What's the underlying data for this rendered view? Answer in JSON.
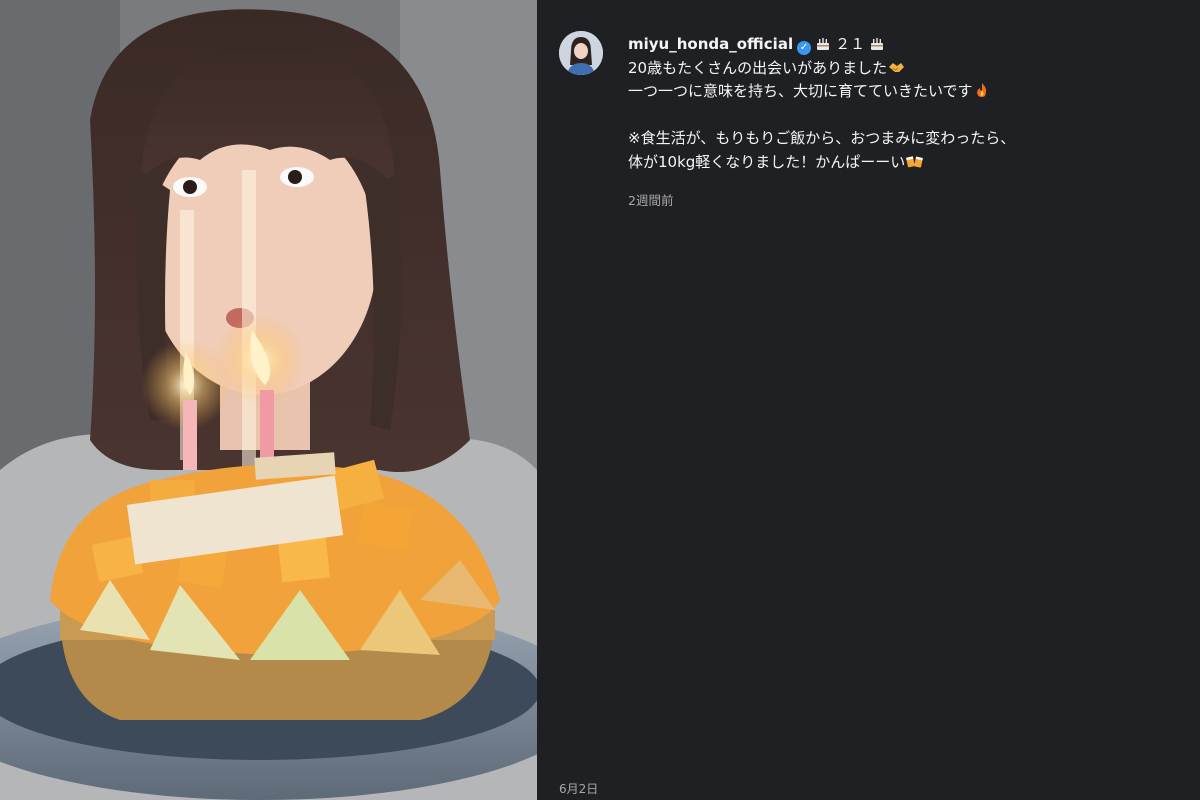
{
  "post": {
    "username": "miyu_honda_official",
    "verified": true,
    "title_badge": "２１",
    "caption_lines": [
      "20歳もたくさんの出会いがありました",
      "一つ一つに意味を持ち、大切に育てていきたいです",
      "",
      "※食生活が、もりもりご飯から、おつまみに変わったら、",
      "体が10kg軽くなりました！かんぱーーい"
    ],
    "relative_time": "2週間前",
    "date": "6月2日"
  },
  "icons": {
    "verified": "verified-badge-icon",
    "cake": "birthday-cake-emoji",
    "handshake": "handshake-emoji",
    "fire": "fire-emoji",
    "beer": "beer-mugs-emoji"
  },
  "colors": {
    "background": "#1f2024",
    "verified_blue": "#3897f0",
    "muted_text": "#a8a8a8"
  }
}
